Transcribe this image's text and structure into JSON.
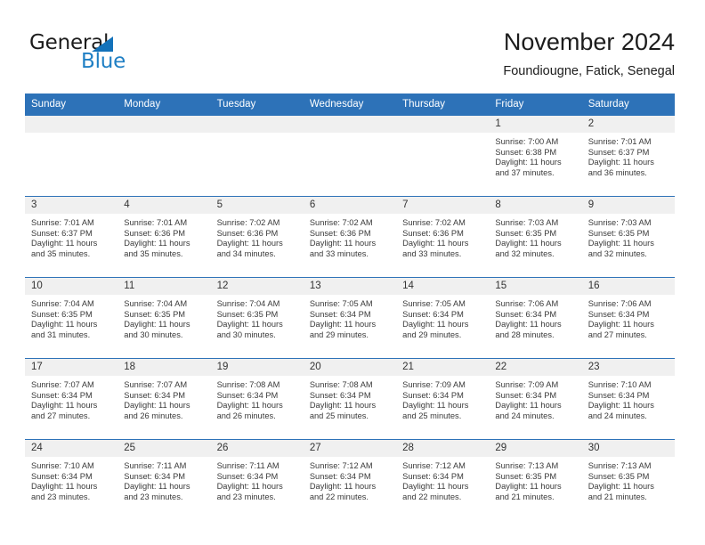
{
  "brand": {
    "name_part1": "General",
    "name_part2": "Blue",
    "triangle_icon": "brand-triangle-icon",
    "colors": {
      "dark": "#1c1c1c",
      "blue": "#1f7fc4"
    }
  },
  "header": {
    "title": "November 2024",
    "subtitle": "Foundiougne, Fatick, Senegal"
  },
  "theme": {
    "header_blue": "#2d72b8",
    "daynum_band": "#f0f0f0",
    "cell_background": "#ffffff",
    "text": "#3a3a3a"
  },
  "calendar": {
    "weekday_headers": [
      "Sunday",
      "Monday",
      "Tuesday",
      "Wednesday",
      "Thursday",
      "Friday",
      "Saturday"
    ],
    "weeks": [
      [
        {
          "day": "",
          "blank": true,
          "sunrise": "",
          "sunset": "",
          "daylight_line1": "",
          "daylight_line2": ""
        },
        {
          "day": "",
          "blank": true,
          "sunrise": "",
          "sunset": "",
          "daylight_line1": "",
          "daylight_line2": ""
        },
        {
          "day": "",
          "blank": true,
          "sunrise": "",
          "sunset": "",
          "daylight_line1": "",
          "daylight_line2": ""
        },
        {
          "day": "",
          "blank": true,
          "sunrise": "",
          "sunset": "",
          "daylight_line1": "",
          "daylight_line2": ""
        },
        {
          "day": "",
          "blank": true,
          "sunrise": "",
          "sunset": "",
          "daylight_line1": "",
          "daylight_line2": ""
        },
        {
          "day": "1",
          "blank": false,
          "sunrise": "Sunrise: 7:00 AM",
          "sunset": "Sunset: 6:38 PM",
          "daylight_line1": "Daylight: 11 hours",
          "daylight_line2": "and 37 minutes."
        },
        {
          "day": "2",
          "blank": false,
          "sunrise": "Sunrise: 7:01 AM",
          "sunset": "Sunset: 6:37 PM",
          "daylight_line1": "Daylight: 11 hours",
          "daylight_line2": "and 36 minutes."
        }
      ],
      [
        {
          "day": "3",
          "blank": false,
          "sunrise": "Sunrise: 7:01 AM",
          "sunset": "Sunset: 6:37 PM",
          "daylight_line1": "Daylight: 11 hours",
          "daylight_line2": "and 35 minutes."
        },
        {
          "day": "4",
          "blank": false,
          "sunrise": "Sunrise: 7:01 AM",
          "sunset": "Sunset: 6:36 PM",
          "daylight_line1": "Daylight: 11 hours",
          "daylight_line2": "and 35 minutes."
        },
        {
          "day": "5",
          "blank": false,
          "sunrise": "Sunrise: 7:02 AM",
          "sunset": "Sunset: 6:36 PM",
          "daylight_line1": "Daylight: 11 hours",
          "daylight_line2": "and 34 minutes."
        },
        {
          "day": "6",
          "blank": false,
          "sunrise": "Sunrise: 7:02 AM",
          "sunset": "Sunset: 6:36 PM",
          "daylight_line1": "Daylight: 11 hours",
          "daylight_line2": "and 33 minutes."
        },
        {
          "day": "7",
          "blank": false,
          "sunrise": "Sunrise: 7:02 AM",
          "sunset": "Sunset: 6:36 PM",
          "daylight_line1": "Daylight: 11 hours",
          "daylight_line2": "and 33 minutes."
        },
        {
          "day": "8",
          "blank": false,
          "sunrise": "Sunrise: 7:03 AM",
          "sunset": "Sunset: 6:35 PM",
          "daylight_line1": "Daylight: 11 hours",
          "daylight_line2": "and 32 minutes."
        },
        {
          "day": "9",
          "blank": false,
          "sunrise": "Sunrise: 7:03 AM",
          "sunset": "Sunset: 6:35 PM",
          "daylight_line1": "Daylight: 11 hours",
          "daylight_line2": "and 32 minutes."
        }
      ],
      [
        {
          "day": "10",
          "blank": false,
          "sunrise": "Sunrise: 7:04 AM",
          "sunset": "Sunset: 6:35 PM",
          "daylight_line1": "Daylight: 11 hours",
          "daylight_line2": "and 31 minutes."
        },
        {
          "day": "11",
          "blank": false,
          "sunrise": "Sunrise: 7:04 AM",
          "sunset": "Sunset: 6:35 PM",
          "daylight_line1": "Daylight: 11 hours",
          "daylight_line2": "and 30 minutes."
        },
        {
          "day": "12",
          "blank": false,
          "sunrise": "Sunrise: 7:04 AM",
          "sunset": "Sunset: 6:35 PM",
          "daylight_line1": "Daylight: 11 hours",
          "daylight_line2": "and 30 minutes."
        },
        {
          "day": "13",
          "blank": false,
          "sunrise": "Sunrise: 7:05 AM",
          "sunset": "Sunset: 6:34 PM",
          "daylight_line1": "Daylight: 11 hours",
          "daylight_line2": "and 29 minutes."
        },
        {
          "day": "14",
          "blank": false,
          "sunrise": "Sunrise: 7:05 AM",
          "sunset": "Sunset: 6:34 PM",
          "daylight_line1": "Daylight: 11 hours",
          "daylight_line2": "and 29 minutes."
        },
        {
          "day": "15",
          "blank": false,
          "sunrise": "Sunrise: 7:06 AM",
          "sunset": "Sunset: 6:34 PM",
          "daylight_line1": "Daylight: 11 hours",
          "daylight_line2": "and 28 minutes."
        },
        {
          "day": "16",
          "blank": false,
          "sunrise": "Sunrise: 7:06 AM",
          "sunset": "Sunset: 6:34 PM",
          "daylight_line1": "Daylight: 11 hours",
          "daylight_line2": "and 27 minutes."
        }
      ],
      [
        {
          "day": "17",
          "blank": false,
          "sunrise": "Sunrise: 7:07 AM",
          "sunset": "Sunset: 6:34 PM",
          "daylight_line1": "Daylight: 11 hours",
          "daylight_line2": "and 27 minutes."
        },
        {
          "day": "18",
          "blank": false,
          "sunrise": "Sunrise: 7:07 AM",
          "sunset": "Sunset: 6:34 PM",
          "daylight_line1": "Daylight: 11 hours",
          "daylight_line2": "and 26 minutes."
        },
        {
          "day": "19",
          "blank": false,
          "sunrise": "Sunrise: 7:08 AM",
          "sunset": "Sunset: 6:34 PM",
          "daylight_line1": "Daylight: 11 hours",
          "daylight_line2": "and 26 minutes."
        },
        {
          "day": "20",
          "blank": false,
          "sunrise": "Sunrise: 7:08 AM",
          "sunset": "Sunset: 6:34 PM",
          "daylight_line1": "Daylight: 11 hours",
          "daylight_line2": "and 25 minutes."
        },
        {
          "day": "21",
          "blank": false,
          "sunrise": "Sunrise: 7:09 AM",
          "sunset": "Sunset: 6:34 PM",
          "daylight_line1": "Daylight: 11 hours",
          "daylight_line2": "and 25 minutes."
        },
        {
          "day": "22",
          "blank": false,
          "sunrise": "Sunrise: 7:09 AM",
          "sunset": "Sunset: 6:34 PM",
          "daylight_line1": "Daylight: 11 hours",
          "daylight_line2": "and 24 minutes."
        },
        {
          "day": "23",
          "blank": false,
          "sunrise": "Sunrise: 7:10 AM",
          "sunset": "Sunset: 6:34 PM",
          "daylight_line1": "Daylight: 11 hours",
          "daylight_line2": "and 24 minutes."
        }
      ],
      [
        {
          "day": "24",
          "blank": false,
          "sunrise": "Sunrise: 7:10 AM",
          "sunset": "Sunset: 6:34 PM",
          "daylight_line1": "Daylight: 11 hours",
          "daylight_line2": "and 23 minutes."
        },
        {
          "day": "25",
          "blank": false,
          "sunrise": "Sunrise: 7:11 AM",
          "sunset": "Sunset: 6:34 PM",
          "daylight_line1": "Daylight: 11 hours",
          "daylight_line2": "and 23 minutes."
        },
        {
          "day": "26",
          "blank": false,
          "sunrise": "Sunrise: 7:11 AM",
          "sunset": "Sunset: 6:34 PM",
          "daylight_line1": "Daylight: 11 hours",
          "daylight_line2": "and 23 minutes."
        },
        {
          "day": "27",
          "blank": false,
          "sunrise": "Sunrise: 7:12 AM",
          "sunset": "Sunset: 6:34 PM",
          "daylight_line1": "Daylight: 11 hours",
          "daylight_line2": "and 22 minutes."
        },
        {
          "day": "28",
          "blank": false,
          "sunrise": "Sunrise: 7:12 AM",
          "sunset": "Sunset: 6:34 PM",
          "daylight_line1": "Daylight: 11 hours",
          "daylight_line2": "and 22 minutes."
        },
        {
          "day": "29",
          "blank": false,
          "sunrise": "Sunrise: 7:13 AM",
          "sunset": "Sunset: 6:35 PM",
          "daylight_line1": "Daylight: 11 hours",
          "daylight_line2": "and 21 minutes."
        },
        {
          "day": "30",
          "blank": false,
          "sunrise": "Sunrise: 7:13 AM",
          "sunset": "Sunset: 6:35 PM",
          "daylight_line1": "Daylight: 11 hours",
          "daylight_line2": "and 21 minutes."
        }
      ]
    ]
  }
}
